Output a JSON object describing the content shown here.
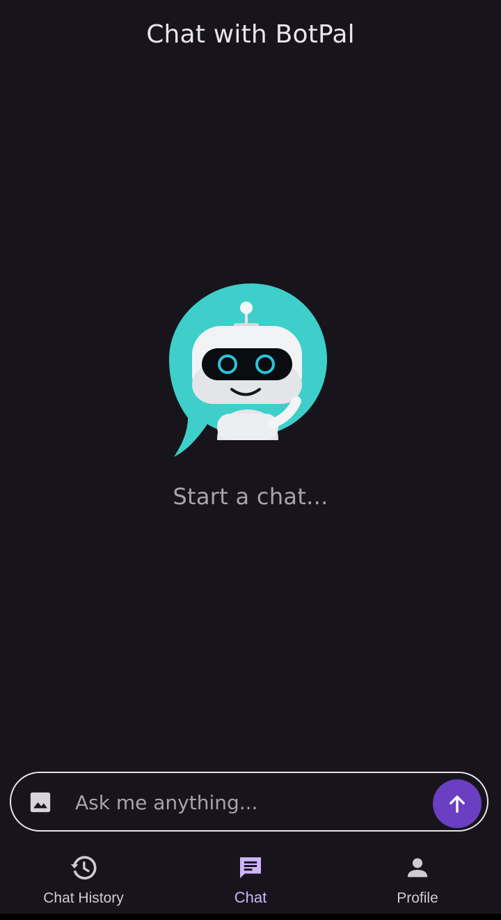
{
  "app_bar": {
    "title": "Chat with BotPal"
  },
  "empty_state": {
    "illustration": "robot-chat-bubble",
    "text": "Start a chat..."
  },
  "composer": {
    "image_icon": "image-icon",
    "placeholder": "Ask me anything...",
    "value": "",
    "send_icon": "arrow-up-icon"
  },
  "bottom_nav": {
    "items": [
      {
        "label": "Chat History",
        "icon": "history-icon",
        "active": false
      },
      {
        "label": "Chat",
        "icon": "chat-icon",
        "active": true
      },
      {
        "label": "Profile",
        "icon": "person-icon",
        "active": false
      }
    ]
  },
  "colors": {
    "background": "#17151b",
    "accent": "#6a3fc1",
    "active_nav": "#cdb5ff",
    "bubble": "#3ecfca"
  }
}
